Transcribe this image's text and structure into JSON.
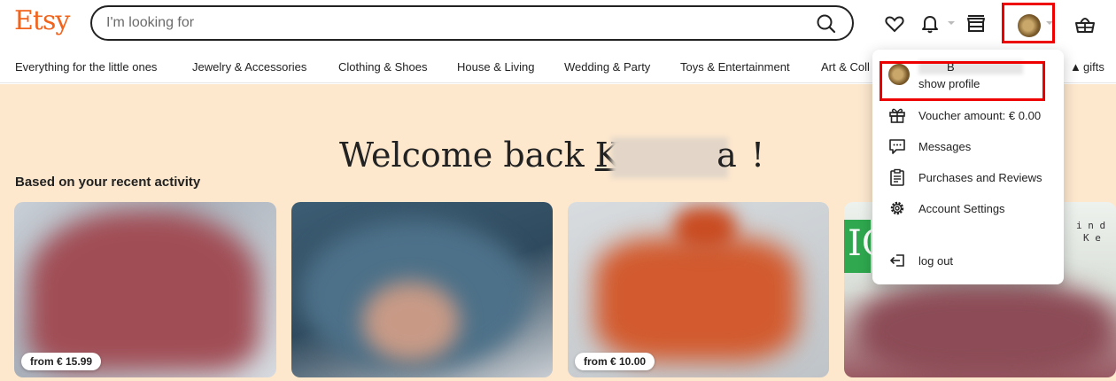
{
  "header": {
    "logo": "Etsy",
    "search_placeholder": "I'm looking for",
    "icons": [
      "search-icon",
      "heart-icon",
      "bell-icon",
      "shop-icon",
      "avatar",
      "cart-icon"
    ]
  },
  "nav": {
    "items": [
      "Everything for the little ones",
      "Jewelry & Accessories",
      "Clothing & Shoes",
      "House & Living",
      "Wedding & Party",
      "Toys & Entertainment",
      "Art & Coll",
      "gifts"
    ]
  },
  "hero": {
    "welcome_prefix": "Welcome back",
    "name_visible_start": "K",
    "name_visible_end": "a",
    "welcome_suffix": " !",
    "section_title": "Based on your recent activity"
  },
  "cards": [
    {
      "price": "from € 15.99"
    },
    {
      "price": ""
    },
    {
      "price": "from € 10.00"
    },
    {
      "price": ""
    }
  ],
  "card_fragment_text": [
    "IC",
    "i n d",
    "K e"
  ],
  "account_menu": {
    "user_initial": "B",
    "show_profile": "show profile",
    "items": [
      {
        "label": "Voucher amount: € 0.00",
        "icon": "gift-icon"
      },
      {
        "label": "Messages",
        "icon": "message-icon"
      },
      {
        "label": "Purchases and Reviews",
        "icon": "clipboard-icon"
      },
      {
        "label": "Account Settings",
        "icon": "gear-icon"
      },
      {
        "label": "log out",
        "icon": "logout-icon"
      }
    ]
  },
  "colors": {
    "brand": "#f1641e",
    "hero_bg": "#fde8ce",
    "highlight": "#e00000"
  }
}
